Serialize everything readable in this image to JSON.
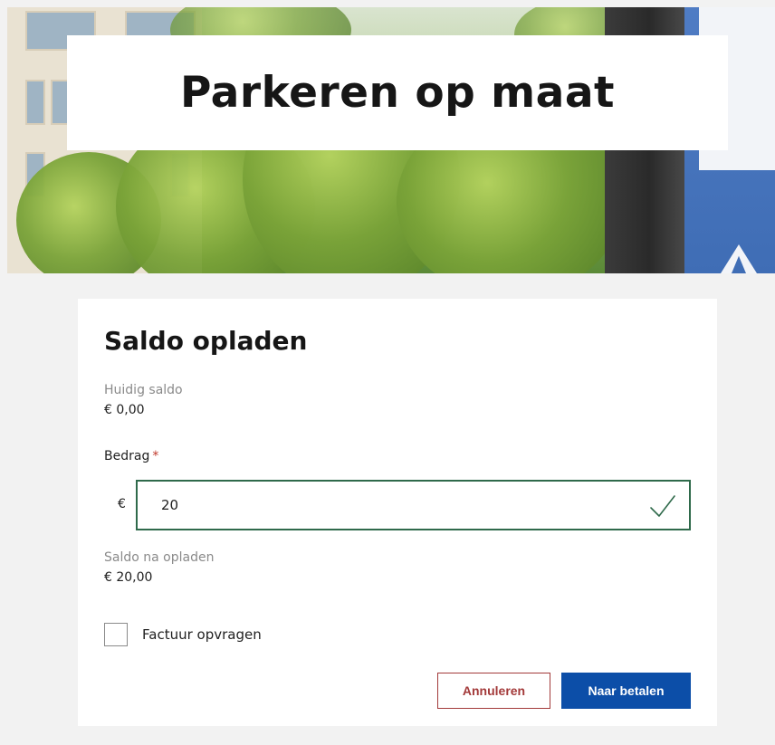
{
  "hero": {
    "title": "Parkeren op maat"
  },
  "card": {
    "heading": "Saldo opladen",
    "current_balance_label": "Huidig saldo",
    "current_balance_value": "€ 0,00",
    "amount_label": "Bedrag",
    "amount_required_marker": "*",
    "currency_symbol": "€",
    "amount_value": "20",
    "balance_after_label": "Saldo na opladen",
    "balance_after_value": "€ 20,00",
    "invoice_checkbox_label": "Factuur opvragen",
    "invoice_checked": false,
    "cancel_button": "Annuleren",
    "pay_button": "Naar betalen"
  },
  "colors": {
    "primary_button": "#0c4ea8",
    "cancel_border": "#a33a3a",
    "input_valid_border": "#2f6a4b",
    "required_marker": "#c0392b"
  },
  "icons": {
    "valid": "checkmark-icon"
  }
}
